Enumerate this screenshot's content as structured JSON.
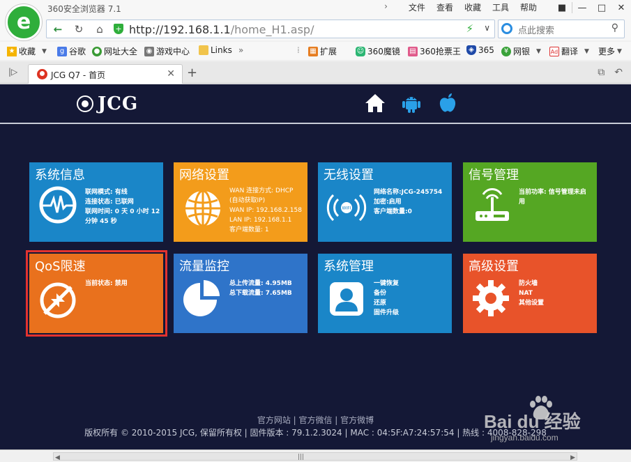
{
  "browser": {
    "app_title": "360安全浏览器 7.1",
    "menus": [
      "文件",
      "查看",
      "收藏",
      "工具",
      "帮助"
    ],
    "url_host": "http://192.168.1.1",
    "url_path": "/home_H1.asp/",
    "search_placeholder": "点此搜索",
    "bookmarks": [
      {
        "label": "收藏",
        "icon": "star-icon"
      },
      {
        "label": "谷歌",
        "icon": "google-icon"
      },
      {
        "label": "网址大全",
        "icon": "web-directory-icon"
      },
      {
        "label": "游戏中心",
        "icon": "gamepad-icon"
      },
      {
        "label": "Links",
        "icon": "folder-icon"
      }
    ],
    "bookmarks_right": [
      {
        "label": "扩展",
        "icon": "grid-icon"
      },
      {
        "label": "360魔镜",
        "icon": "mirror-icon"
      },
      {
        "label": "360抢票王",
        "icon": "ticket-icon"
      },
      {
        "label": "365",
        "icon": "shield-icon"
      },
      {
        "label": "网银",
        "icon": "bank-icon"
      },
      {
        "label": "翻译",
        "icon": "translate-icon"
      },
      {
        "label": "更多",
        "icon": "more-icon"
      }
    ],
    "tab_title": "JCG Q7 - 首页",
    "more_chevrons": "»"
  },
  "page": {
    "brand": "JCG",
    "tiles": [
      {
        "title": "系统信息",
        "info": [
          "联网模式: 有线",
          "连接状态: 已联网",
          "联网时间: 0 天 0 小时 12",
          "分钟 45 秒"
        ]
      },
      {
        "title": "网络设置",
        "info": [
          "WAN 连接方式: DHCP",
          "(自动获取IP)",
          "WAN IP: 192.168.2.158",
          "LAN IP: 192.168.1.1",
          "客户端数量: 1"
        ]
      },
      {
        "title": "无线设置",
        "info": [
          "网络名称:JCG-245754",
          "加密:启用",
          "客户端数量:0"
        ]
      },
      {
        "title": "信号管理",
        "info": [
          "当前功率: 信号管理未启",
          "用"
        ]
      },
      {
        "title": "QoS限速",
        "info": [
          "当前状态: 禁用"
        ]
      },
      {
        "title": "流量监控",
        "info": [
          "总上传流量: 4.95MB",
          "总下载流量: 7.65MB"
        ]
      },
      {
        "title": "系统管理",
        "info": [
          "一键恢复",
          "备份",
          "还原",
          "固件升级"
        ]
      },
      {
        "title": "高级设置",
        "info": [
          "防火墙",
          "NAT",
          "其他设置"
        ]
      }
    ],
    "footer_links": "官方网站 | 官方微信 | 官方微博",
    "footer_copy": "版权所有 © 2010-2015 JCG, 保留所有权 | 固件版本 : 79.1.2.3024 | MAC : 04:5F:A7:24:57:54 | 热线 : 4008-828-298"
  },
  "watermark": {
    "brand": "Bai du 经验",
    "url": "jingyan.baidu.com"
  }
}
